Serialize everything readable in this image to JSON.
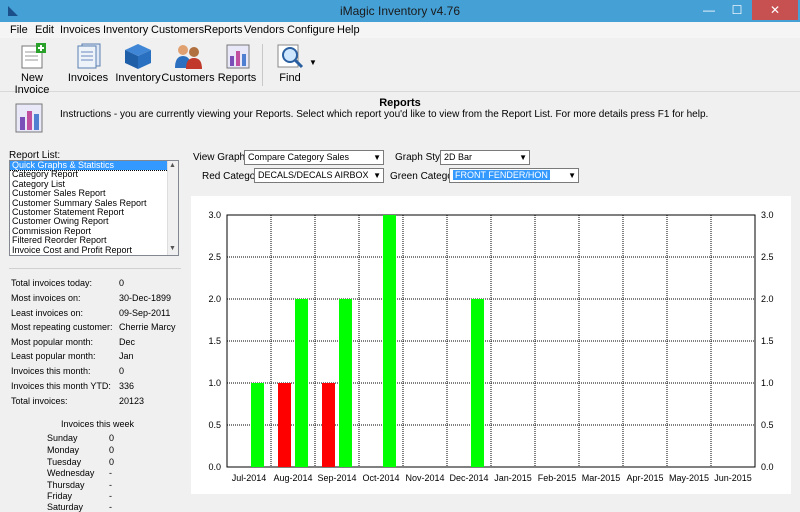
{
  "window": {
    "title": "iMagic Inventory v4.76"
  },
  "menu": [
    "File",
    "Edit",
    "Invoices",
    "Inventory",
    "Customers",
    "Reports",
    "Vendors",
    "Configure",
    "Help"
  ],
  "toolbar": {
    "new_invoice": "New Invoice",
    "invoices": "Invoices",
    "inventory": "Inventory",
    "customers": "Customers",
    "reports": "Reports",
    "find": "Find"
  },
  "header": {
    "title": "Reports",
    "instructions": "Instructions - you are currently viewing your Reports. Select which report you'd like to view from the Report List. For more details press F1 for help."
  },
  "report_list": {
    "label": "Report List:",
    "items": [
      "Quick Graphs & Statistics",
      "Category Report",
      "Category List",
      "Customer Sales Report",
      "Customer Summary Sales Report",
      "Customer Statement Report",
      "Customer Owing Report",
      "Commission Report",
      "Filtered Reorder Report",
      "Invoice Cost and Profit Report"
    ],
    "selected": "Quick Graphs & Statistics"
  },
  "stats": [
    {
      "label": "Total invoices today:",
      "value": "0"
    },
    {
      "label": "Most invoices on:",
      "value": "30-Dec-1899"
    },
    {
      "label": "Least invoices on:",
      "value": "09-Sep-2011"
    },
    {
      "label": "Most repeating customer:",
      "value": "Cherrie Marcy"
    },
    {
      "label": "Most popular month:",
      "value": "Dec"
    },
    {
      "label": "Least popular month:",
      "value": "Jan"
    },
    {
      "label": "Invoices this month:",
      "value": "0"
    },
    {
      "label": "Invoices this month YTD:",
      "value": "336"
    },
    {
      "label": "Total invoices:",
      "value": "20123"
    }
  ],
  "week": {
    "title": "Invoices this week",
    "days": [
      {
        "day": "Sunday",
        "value": "0"
      },
      {
        "day": "Monday",
        "value": "0"
      },
      {
        "day": "Tuesday",
        "value": "0"
      },
      {
        "day": "Wednesday",
        "value": "-"
      },
      {
        "day": "Thursday",
        "value": "-"
      },
      {
        "day": "Friday",
        "value": "-"
      },
      {
        "day": "Saturday",
        "value": "-"
      }
    ]
  },
  "controls": {
    "view_graph_label": "View Graph:",
    "view_graph_value": "Compare Category Sales",
    "graph_style_label": "Graph Style:",
    "graph_style_value": "2D Bar",
    "red_category_label": "Red Category:",
    "red_category_value": "DECALS/DECALS AIRBOX",
    "green_category_label": "Green Category:",
    "green_category_value": "FRONT FENDER/HON"
  },
  "colors": {
    "red": "#ff0000",
    "green": "#00ff00",
    "title_bar": "#45a0d6",
    "selection": "#3399ff"
  },
  "chart_data": {
    "type": "bar",
    "categories": [
      "Jul-2014",
      "Aug-2014",
      "Sep-2014",
      "Oct-2014",
      "Nov-2014",
      "Dec-2014",
      "Jan-2015",
      "Feb-2015",
      "Mar-2015",
      "Apr-2015",
      "May-2015",
      "Jun-2015"
    ],
    "series": [
      {
        "color": "#ff0000",
        "values": [
          0,
          1,
          1,
          0,
          0,
          0,
          0,
          0,
          0,
          0,
          0,
          0
        ]
      },
      {
        "color": "#00ff00",
        "values": [
          1,
          2,
          2,
          3,
          0,
          2,
          0,
          0,
          0,
          0,
          0,
          0
        ]
      }
    ],
    "yticks": [
      "0.0",
      "0.5",
      "1.0",
      "1.5",
      "2.0",
      "2.5",
      "3.0"
    ],
    "ylim": [
      0,
      3
    ],
    "grid": true
  }
}
